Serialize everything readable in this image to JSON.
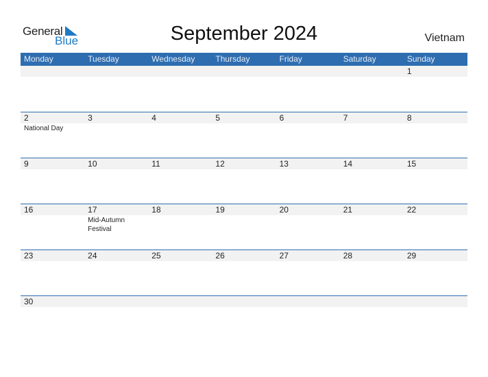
{
  "logo": {
    "text_general": "General",
    "text_blue": "Blue"
  },
  "title": "September 2024",
  "country": "Vietnam",
  "colors": {
    "header": "#2e6db0",
    "accent": "#1f7ac4",
    "date_band": "#f2f2f2"
  },
  "days": [
    "Monday",
    "Tuesday",
    "Wednesday",
    "Thursday",
    "Friday",
    "Saturday",
    "Sunday"
  ],
  "weeks": [
    [
      {
        "d": ""
      },
      {
        "d": ""
      },
      {
        "d": ""
      },
      {
        "d": ""
      },
      {
        "d": ""
      },
      {
        "d": ""
      },
      {
        "d": "1"
      }
    ],
    [
      {
        "d": "2",
        "e": "National Day"
      },
      {
        "d": "3"
      },
      {
        "d": "4"
      },
      {
        "d": "5"
      },
      {
        "d": "6"
      },
      {
        "d": "7"
      },
      {
        "d": "8"
      }
    ],
    [
      {
        "d": "9"
      },
      {
        "d": "10"
      },
      {
        "d": "11"
      },
      {
        "d": "12"
      },
      {
        "d": "13"
      },
      {
        "d": "14"
      },
      {
        "d": "15"
      }
    ],
    [
      {
        "d": "16"
      },
      {
        "d": "17",
        "e": "Mid-Autumn Festival"
      },
      {
        "d": "18"
      },
      {
        "d": "19"
      },
      {
        "d": "20"
      },
      {
        "d": "21"
      },
      {
        "d": "22"
      }
    ],
    [
      {
        "d": "23"
      },
      {
        "d": "24"
      },
      {
        "d": "25"
      },
      {
        "d": "26"
      },
      {
        "d": "27"
      },
      {
        "d": "28"
      },
      {
        "d": "29"
      }
    ],
    [
      {
        "d": "30"
      },
      {
        "d": ""
      },
      {
        "d": ""
      },
      {
        "d": ""
      },
      {
        "d": ""
      },
      {
        "d": ""
      },
      {
        "d": ""
      }
    ]
  ]
}
